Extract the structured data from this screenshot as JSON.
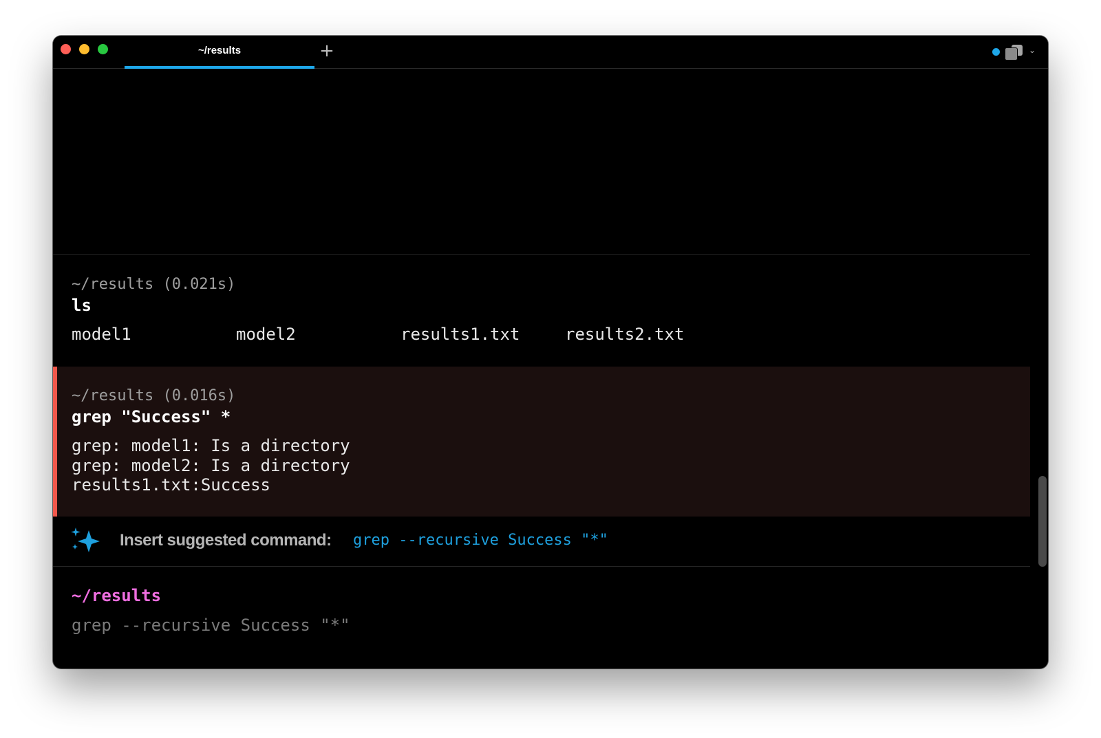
{
  "window": {
    "tab_title": "~/results",
    "new_tab_symbol": "+",
    "chevron": "⌄",
    "colors": {
      "accent": "#1ea7e9",
      "error_bar": "#f2584c",
      "prompt": "#ef6ee0",
      "suggestion": "#1ea0de"
    }
  },
  "blocks": [
    {
      "meta": "~/results (0.021s)",
      "command": "ls",
      "output": [
        "model1",
        "model2",
        "results1.txt",
        "results2.txt"
      ]
    },
    {
      "meta": "~/results (0.016s)",
      "command": "grep \"Success\" *",
      "status": "error",
      "output": [
        "grep: model1: Is a directory",
        "grep: model2: Is a directory",
        "results1.txt:Success"
      ]
    }
  ],
  "suggestion": {
    "label": "Insert suggested command:",
    "command": "grep --recursive Success \"*\"",
    "icon": "sparkle-icon"
  },
  "input": {
    "prompt": "~/results",
    "value": "grep --recursive Success \"*\""
  }
}
